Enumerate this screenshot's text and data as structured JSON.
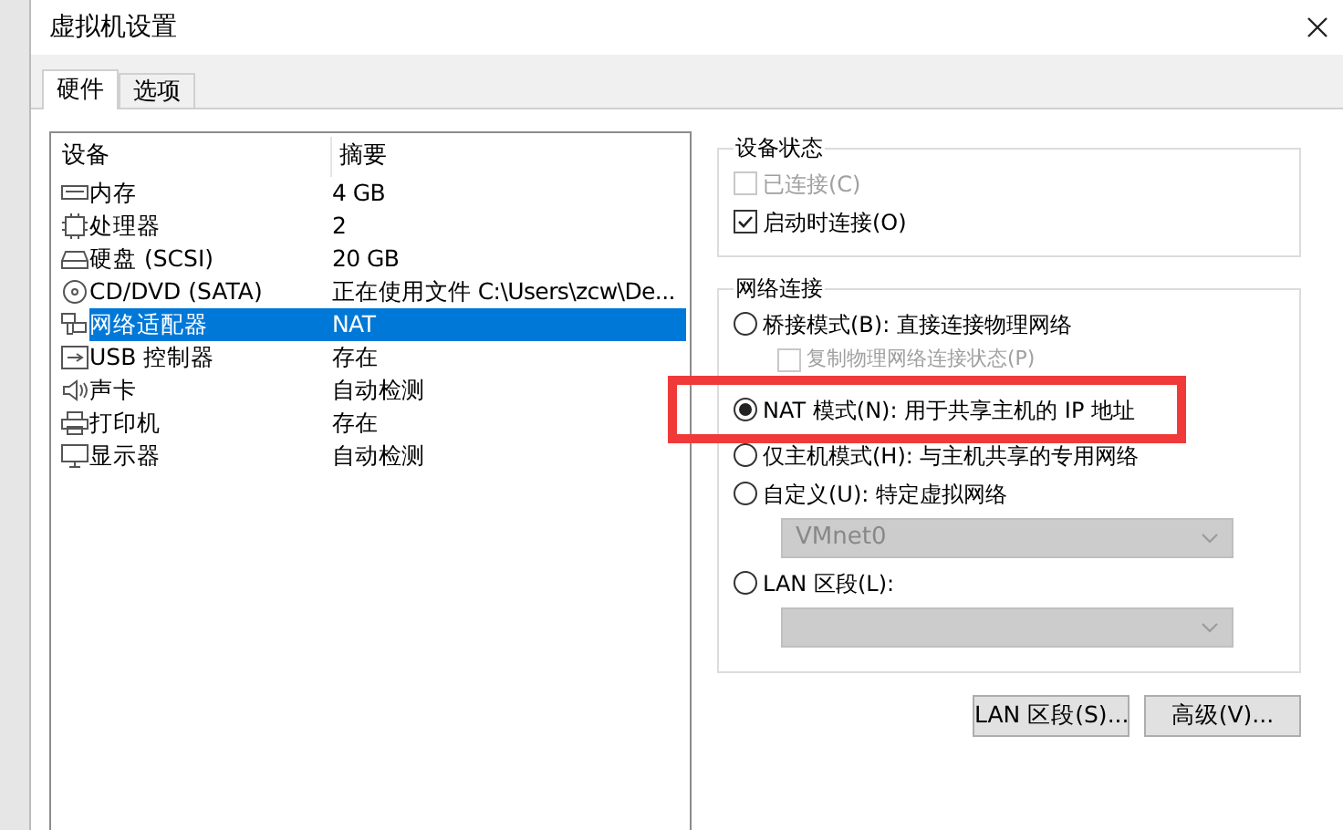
{
  "window": {
    "title": "虚拟机设置"
  },
  "tabs": [
    {
      "label": "硬件",
      "selected": true
    },
    {
      "label": "选项",
      "selected": false
    }
  ],
  "devices": {
    "columns": [
      "设备",
      "摘要"
    ],
    "rows": [
      {
        "kind": "memory",
        "name": "内存",
        "summary": "4 GB",
        "selected": false
      },
      {
        "kind": "cpu",
        "name": "处理器",
        "summary": "2",
        "selected": false
      },
      {
        "kind": "disk",
        "name": "硬盘 (SCSI)",
        "summary": "20 GB",
        "selected": false
      },
      {
        "kind": "cd",
        "name": "CD/DVD (SATA)",
        "summary": "正在使用文件 C:\\Users\\zcw\\De...",
        "selected": false
      },
      {
        "kind": "network",
        "name": "网络适配器",
        "summary": "NAT",
        "selected": true
      },
      {
        "kind": "usb",
        "name": "USB 控制器",
        "summary": "存在",
        "selected": false
      },
      {
        "kind": "sound",
        "name": "声卡",
        "summary": "自动检测",
        "selected": false
      },
      {
        "kind": "printer",
        "name": "打印机",
        "summary": "存在",
        "selected": false
      },
      {
        "kind": "display",
        "name": "显示器",
        "summary": "自动检测",
        "selected": false
      }
    ]
  },
  "device_status": {
    "title": "设备状态",
    "options": [
      {
        "label": "已连接(C)",
        "checked": false,
        "disabled": true
      },
      {
        "label": "启动时连接(O)",
        "checked": true,
        "disabled": false
      }
    ]
  },
  "network": {
    "title": "网络连接",
    "options": [
      {
        "kind": "radio",
        "label": "桥接模式(B): 直接连接物理网络",
        "selected": false,
        "disabled": false
      },
      {
        "kind": "checkbox",
        "label": "复制物理网络连接状态(P)",
        "checked": false,
        "disabled": true
      },
      {
        "kind": "radio",
        "label": "NAT 模式(N): 用于共享主机的 IP 地址",
        "selected": true,
        "disabled": false,
        "highlighted": true
      },
      {
        "kind": "radio",
        "label": "仅主机模式(H): 与主机共享的专用网络",
        "selected": false,
        "disabled": false
      },
      {
        "kind": "radio",
        "label": "自定义(U): 特定虚拟网络",
        "selected": false,
        "disabled": false
      },
      {
        "kind": "select",
        "value": "VMnet0",
        "disabled": true
      },
      {
        "kind": "radio",
        "label": "LAN 区段(L):",
        "selected": false,
        "disabled": false
      },
      {
        "kind": "select",
        "disabled": true
      }
    ]
  },
  "buttons": [
    "LAN 区段(S)...",
    "高级(V)..."
  ]
}
